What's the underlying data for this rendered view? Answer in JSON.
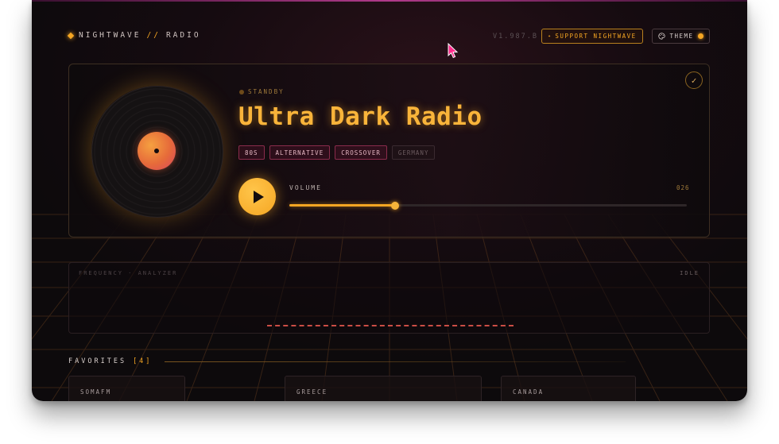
{
  "header": {
    "brand": {
      "name": "NIGHTWAVE",
      "separator": "//",
      "suffix": "RADIO"
    },
    "version": "V1.987.B",
    "support_button": {
      "icon": "star-icon",
      "label": "SUPPORT NIGHTWAVE"
    },
    "theme_button": {
      "icon": "palette-icon",
      "label": "THEME"
    }
  },
  "player": {
    "status": "STANDBY",
    "station_title": "Ultra Dark Radio",
    "tags": [
      "80S",
      "ALTERNATIVE",
      "CROSSOVER",
      "GERMANY"
    ],
    "volume_label": "VOLUME",
    "volume_value": "026",
    "volume_fraction": 0.265,
    "play_icon": "play-icon",
    "check_icon": "check-icon"
  },
  "analyzer": {
    "title": "FREQUENCY · ANALYZER",
    "status": "IDLE"
  },
  "favorites": {
    "label": "FAVORITES",
    "count": "[4]",
    "items": [
      "SOMAFM",
      "GREECE",
      "CANADA"
    ]
  },
  "colors": {
    "accent": "#f5a623",
    "background": "#150b10",
    "tag_border": "#8a2c4c",
    "cursor": "#ff2a8a"
  }
}
